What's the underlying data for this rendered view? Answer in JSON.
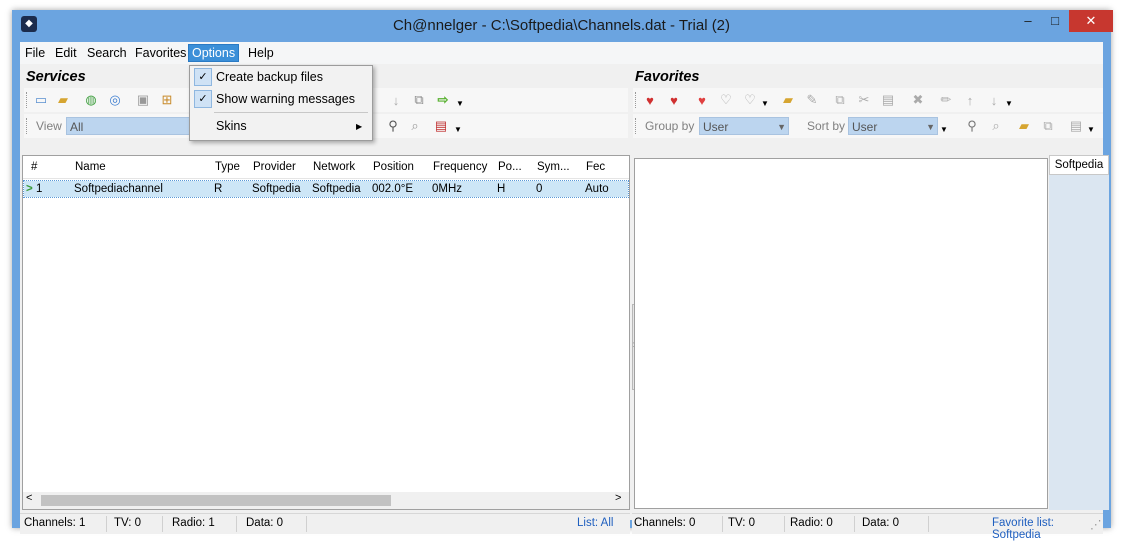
{
  "window": {
    "title": "Ch@nnelger - C:\\Softpedia\\Channels.dat - Trial (2)",
    "minimize_glyph": "–",
    "maximize_glyph": "□",
    "close_glyph": "✕"
  },
  "menubar": {
    "file": "File",
    "edit": "Edit",
    "search": "Search",
    "favorites": "Favorites",
    "options": "Options",
    "help": "Help"
  },
  "options_menu": {
    "items": [
      {
        "label": "Create backup files",
        "checked": true
      },
      {
        "label": "Show warning messages",
        "checked": true
      },
      {
        "label": "Skins",
        "submenu": true
      }
    ],
    "check_glyph": "✓",
    "submenu_glyph": "▶"
  },
  "services": {
    "title": "Services",
    "view_label": "View",
    "view_value": "All",
    "columns": [
      "#",
      "Name",
      "Type",
      "Provider",
      "Network",
      "Position",
      "Frequency",
      "Po...",
      "Sym...",
      "Fec"
    ],
    "rows": [
      {
        "index": "1",
        "name": "Softpediachannel",
        "type": "R",
        "provider": "Softpedia",
        "network": "Softpedia",
        "position": "002.0°E",
        "frequency": "0MHz",
        "polarization": "H",
        "symbol_rate": "0",
        "fec": "Auto"
      }
    ],
    "row_marker": ">",
    "scroll_left": "<",
    "scroll_right": ">",
    "status": {
      "channels": "Channels: 1",
      "tv": "TV: 0",
      "radio": "Radio: 1",
      "data": "Data: 0",
      "list": "List: All"
    }
  },
  "favorites": {
    "title": "Favorites",
    "group_by_label": "Group by",
    "group_by_value": "User",
    "sort_by_label": "Sort by",
    "sort_by_value": "User",
    "tab_label": "Softpedia",
    "status": {
      "channels": "Channels: 0",
      "tv": "TV: 0",
      "radio": "Radio: 0",
      "data": "Data: 0",
      "favorite_list": "Favorite list: Softpedia"
    }
  },
  "icons": {
    "new": "▭",
    "open": "📂",
    "globe1": "◍",
    "globe2": "◎",
    "save": "▣",
    "export": "⊞",
    "down_arrow": "↓",
    "copy": "⧉",
    "right_arrow": "⇨",
    "binoculars": "⚲",
    "find": "⌕",
    "doc": "▤",
    "heart_add": "♥",
    "heart_remove": "♥",
    "heart": "♥",
    "heart_grey1": "♡",
    "heart_grey2": "♡",
    "folder_new": "▰",
    "edit_fav": "✎",
    "copy_fav": "⧉",
    "cut": "✂",
    "paste": "▤",
    "delete": "✖",
    "pencil": "✏",
    "up": "↑",
    "down": "↓",
    "splitter_arrow": "›",
    "resize_grip": "⋰"
  },
  "colors": {
    "accent": "#3b8fd8",
    "selection": "#cde6f7",
    "frame": "#6ba4e0",
    "link_blue": "#1f5fbf"
  }
}
